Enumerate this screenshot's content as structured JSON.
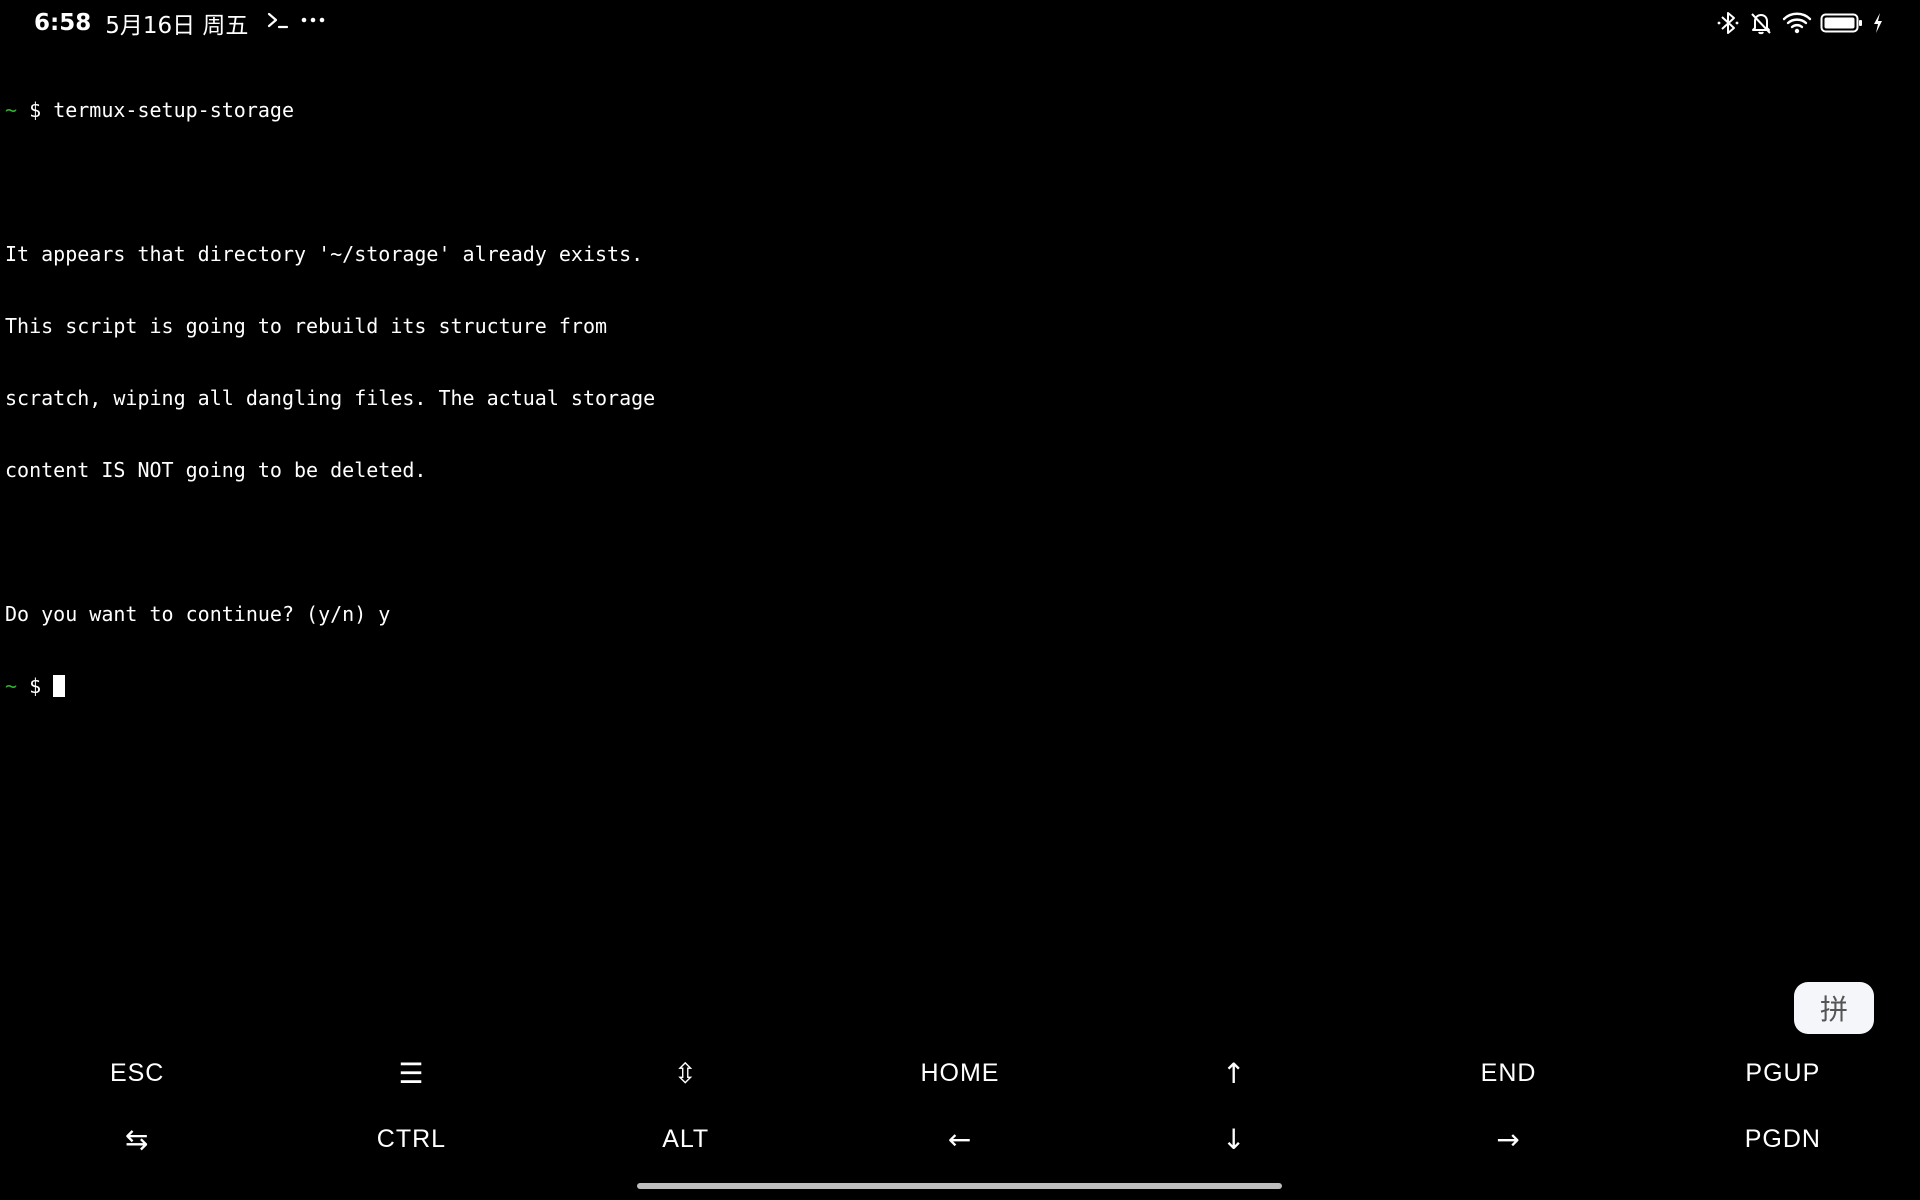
{
  "status_bar": {
    "time": "6:58",
    "date": "5月16日 周五",
    "left_icons": [
      "terminal-prompt-icon",
      "more-dots-icon"
    ],
    "right_icons": [
      "bluetooth-icon",
      "notifications-muted-icon",
      "wifi-icon",
      "battery-icon",
      "charging-icon"
    ]
  },
  "terminal": {
    "prompt_symbol": "~",
    "prompt_dollar": "$",
    "command": "termux-setup-storage",
    "output_lines": [
      "",
      "It appears that directory '~/storage' already exists.",
      "This script is going to rebuild its structure from",
      "scratch, wiping all dangling files. The actual storage",
      "content IS NOT going to be deleted.",
      "",
      "Do you want to continue? (y/n) y"
    ]
  },
  "ime_button": {
    "label": "拼"
  },
  "extra_keys": {
    "row1": [
      "ESC",
      "☰",
      "⇳",
      "HOME",
      "↑",
      "END",
      "PGUP"
    ],
    "row2": [
      "⇆",
      "CTRL",
      "ALT",
      "←",
      "↓",
      "→",
      "PGDN"
    ]
  }
}
